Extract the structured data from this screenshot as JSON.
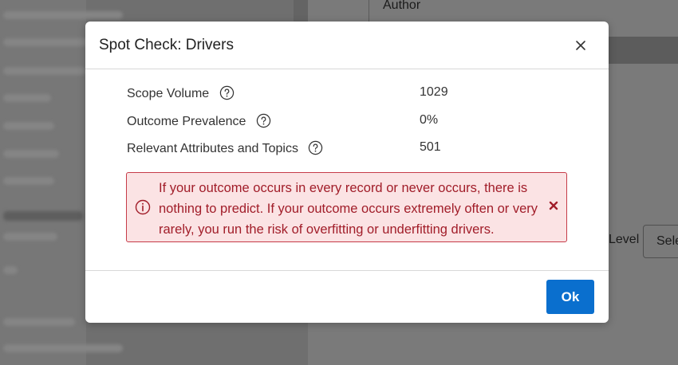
{
  "background": {
    "author_label": "Author",
    "level_label": "Level",
    "select_label": "Sele"
  },
  "modal": {
    "title": "Spot Check: Drivers",
    "close_icon": "close-icon",
    "stats": [
      {
        "label": "Scope Volume",
        "value": "1029",
        "icon": "help-icon"
      },
      {
        "label": "Outcome Prevalence",
        "value": "0%",
        "icon": "help-icon"
      },
      {
        "label": "Relevant Attributes and Topics",
        "value": "501",
        "icon": "help-icon"
      }
    ],
    "alert": {
      "icon": "info-icon",
      "text": "If your outcome occurs in every record or never occurs, there is nothing to predict. If your outcome occurs extremely often or very rarely, you run the risk of overfitting or underfitting drivers.",
      "close_icon": "dismiss-icon"
    },
    "ok_label": "Ok"
  },
  "colors": {
    "primary_button": "#0a6fce",
    "alert_background": "#fbe3e4",
    "alert_border": "#c63b48",
    "alert_text": "#a11d29",
    "overlay": "#6f6f6f"
  }
}
